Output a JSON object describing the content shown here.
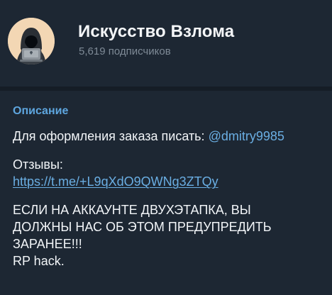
{
  "channel": {
    "title": "Искусство Взлома",
    "subscribers": "5,619 подписчиков"
  },
  "info": {
    "section_title": "Описание",
    "order_text": "Для оформления заказа писать: ",
    "mention": "@dmitry9985",
    "reviews_label": "Отзывы:",
    "reviews_link": "https://t.me/+L9qXdO9QWNg3ZTQy",
    "warning_line_1": "ЕСЛИ НА АККАУНТЕ ДВУХЭТАПКА, ВЫ",
    "warning_line_2": "ДОЛЖНЫ НАС ОБ ЭТОМ ПРЕДУПРЕДИТЬ",
    "warning_line_3": "ЗАРАНЕЕ!!!",
    "signature": "RP hack."
  },
  "colors": {
    "background": "#1d2733",
    "accent": "#5ea6df",
    "link": "#6aaee3",
    "muted_text": "#7e8a96",
    "text": "#f2f5f8"
  },
  "icons": {
    "avatar": "hooded-hacker-laptop-icon"
  }
}
